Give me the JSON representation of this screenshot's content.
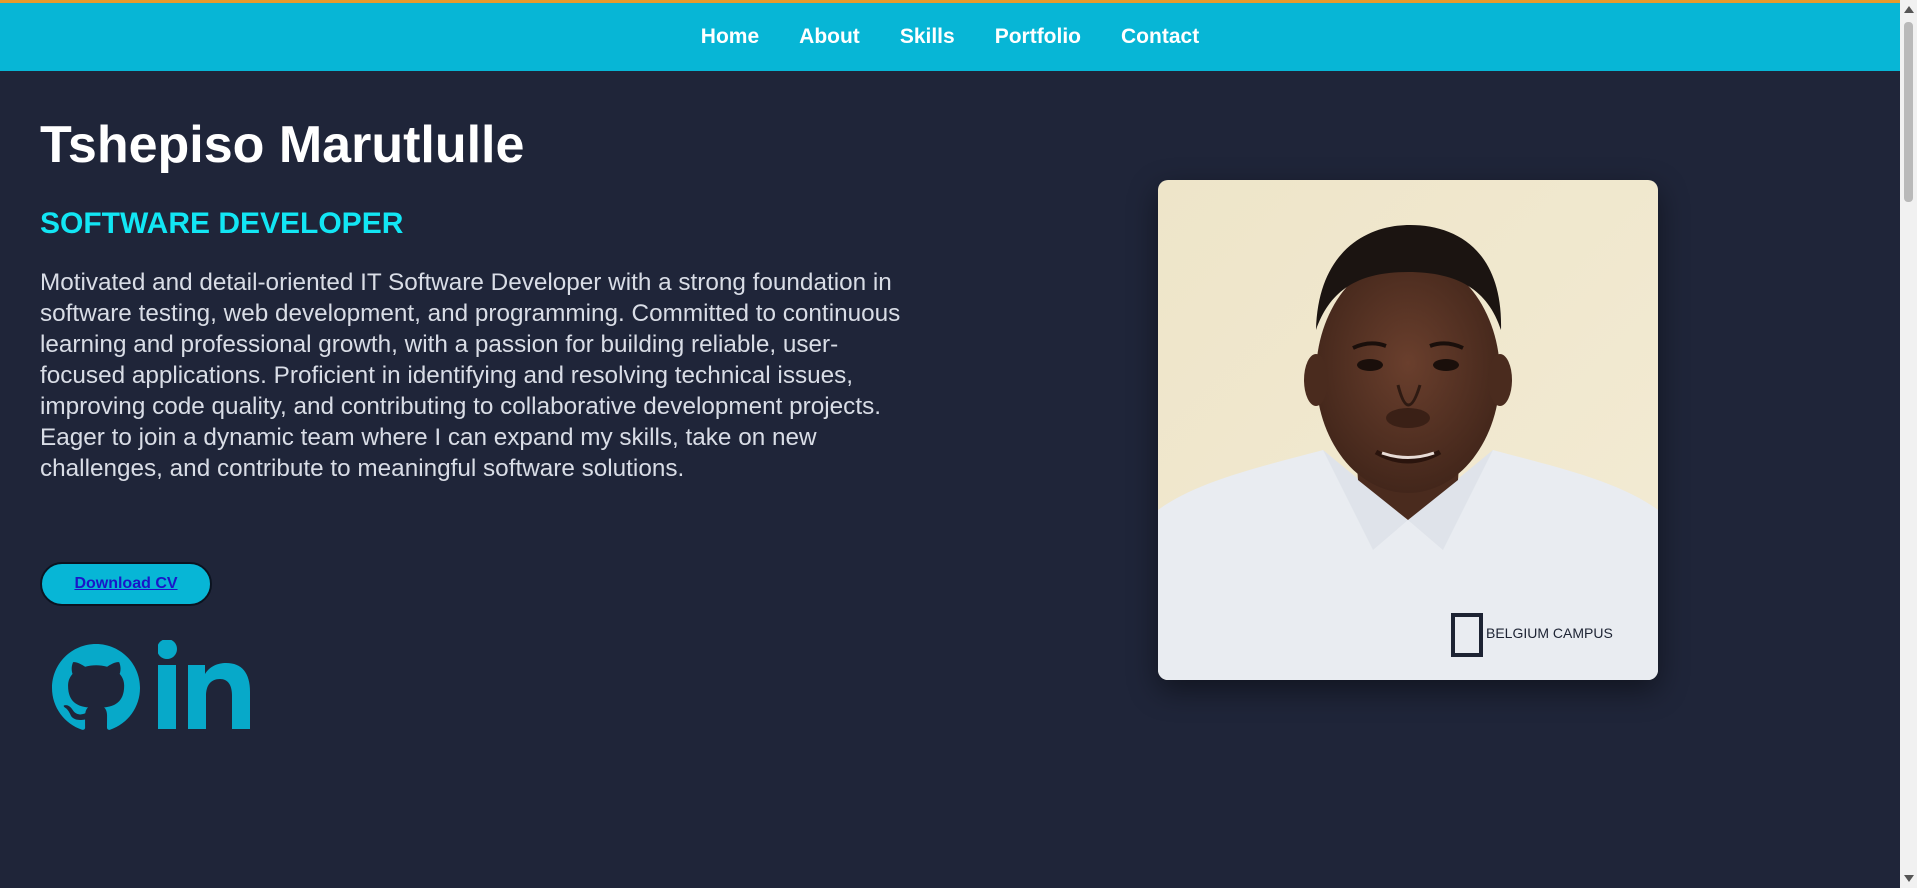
{
  "nav": {
    "items": [
      {
        "label": "Home"
      },
      {
        "label": "About"
      },
      {
        "label": "Skills"
      },
      {
        "label": "Portfolio"
      },
      {
        "label": "Contact"
      }
    ]
  },
  "hero": {
    "name": "Tshepiso Marutlulle",
    "role": "SOFTWARE DEVELOPER",
    "bio": "Motivated and detail-oriented IT Software Developer with a strong foundation in software testing, web development, and programming. Committed to continuous learning and professional growth, with a passion for building reliable, user-focused applications. Proficient in identifying and resolving technical issues, improving code quality, and contributing to collaborative development projects. Eager to join a dynamic team where I can expand my skills, take on new challenges, and contribute to meaningful software solutions.",
    "cv_button": "Download CV",
    "social": [
      {
        "icon": "github-icon"
      },
      {
        "icon": "linkedin-icon"
      }
    ]
  },
  "photo": {
    "shirt_logo_text": "BELGIUM CAMPUS"
  },
  "colors": {
    "nav_bg": "#07b6d6",
    "page_bg": "#1f2539",
    "accent": "#12e6f4",
    "top_line": "#e89a2c"
  }
}
